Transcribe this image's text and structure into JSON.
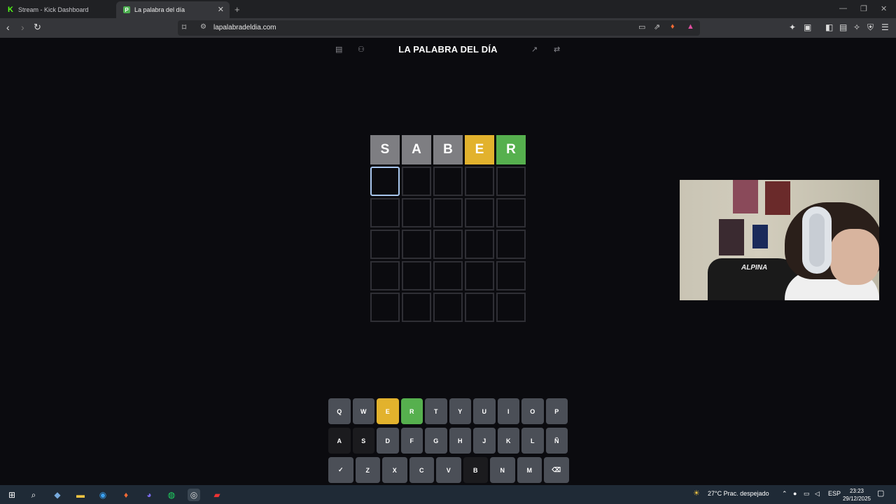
{
  "browser": {
    "tabs": [
      {
        "title": "Stream - Kick Dashboard",
        "icon": "kick-icon"
      },
      {
        "title": "La palabra del día",
        "icon": "palabra-icon",
        "active": true
      }
    ],
    "url": "lapalabradeldia.com"
  },
  "page": {
    "title": "LA PALABRA DEL DÍA"
  },
  "board": {
    "rows": [
      [
        {
          "letter": "S",
          "state": "absent"
        },
        {
          "letter": "A",
          "state": "absent"
        },
        {
          "letter": "B",
          "state": "absent"
        },
        {
          "letter": "E",
          "state": "present"
        },
        {
          "letter": "R",
          "state": "correct"
        }
      ],
      [
        {
          "letter": "",
          "state": "active"
        },
        {
          "letter": "",
          "state": "empty"
        },
        {
          "letter": "",
          "state": "empty"
        },
        {
          "letter": "",
          "state": "empty"
        },
        {
          "letter": "",
          "state": "empty"
        }
      ],
      [
        {
          "letter": "",
          "state": "empty"
        },
        {
          "letter": "",
          "state": "empty"
        },
        {
          "letter": "",
          "state": "empty"
        },
        {
          "letter": "",
          "state": "empty"
        },
        {
          "letter": "",
          "state": "empty"
        }
      ],
      [
        {
          "letter": "",
          "state": "empty"
        },
        {
          "letter": "",
          "state": "empty"
        },
        {
          "letter": "",
          "state": "empty"
        },
        {
          "letter": "",
          "state": "empty"
        },
        {
          "letter": "",
          "state": "empty"
        }
      ],
      [
        {
          "letter": "",
          "state": "empty"
        },
        {
          "letter": "",
          "state": "empty"
        },
        {
          "letter": "",
          "state": "empty"
        },
        {
          "letter": "",
          "state": "empty"
        },
        {
          "letter": "",
          "state": "empty"
        }
      ],
      [
        {
          "letter": "",
          "state": "empty"
        },
        {
          "letter": "",
          "state": "empty"
        },
        {
          "letter": "",
          "state": "empty"
        },
        {
          "letter": "",
          "state": "empty"
        },
        {
          "letter": "",
          "state": "empty"
        }
      ]
    ]
  },
  "keyboard": {
    "rows": [
      [
        {
          "key": "Q",
          "state": "unused"
        },
        {
          "key": "W",
          "state": "unused"
        },
        {
          "key": "E",
          "state": "present"
        },
        {
          "key": "R",
          "state": "correct"
        },
        {
          "key": "T",
          "state": "unused"
        },
        {
          "key": "Y",
          "state": "unused"
        },
        {
          "key": "U",
          "state": "unused"
        },
        {
          "key": "I",
          "state": "unused"
        },
        {
          "key": "O",
          "state": "unused"
        },
        {
          "key": "P",
          "state": "unused"
        }
      ],
      [
        {
          "key": "A",
          "state": "absent"
        },
        {
          "key": "S",
          "state": "absent"
        },
        {
          "key": "D",
          "state": "unused"
        },
        {
          "key": "F",
          "state": "unused"
        },
        {
          "key": "G",
          "state": "unused"
        },
        {
          "key": "H",
          "state": "unused"
        },
        {
          "key": "J",
          "state": "unused"
        },
        {
          "key": "K",
          "state": "unused"
        },
        {
          "key": "L",
          "state": "unused"
        },
        {
          "key": "Ñ",
          "state": "unused"
        }
      ],
      [
        {
          "key": "✓",
          "state": "unused",
          "name": "enter-key"
        },
        {
          "key": "Z",
          "state": "unused"
        },
        {
          "key": "X",
          "state": "unused"
        },
        {
          "key": "C",
          "state": "unused"
        },
        {
          "key": "V",
          "state": "unused"
        },
        {
          "key": "B",
          "state": "absent"
        },
        {
          "key": "N",
          "state": "unused"
        },
        {
          "key": "M",
          "state": "unused"
        },
        {
          "key": "⌫",
          "state": "unused",
          "name": "backspace-key"
        }
      ]
    ]
  },
  "webcam": {
    "chair_text": "ALPINA"
  },
  "taskbar": {
    "weather": "27°C  Prac. despejado",
    "language": "ESP",
    "time": "23:23",
    "date": "29/12/2025"
  },
  "colors": {
    "correct": "#56b04e",
    "present": "#e2b22d",
    "absent": "#7e7e82"
  }
}
